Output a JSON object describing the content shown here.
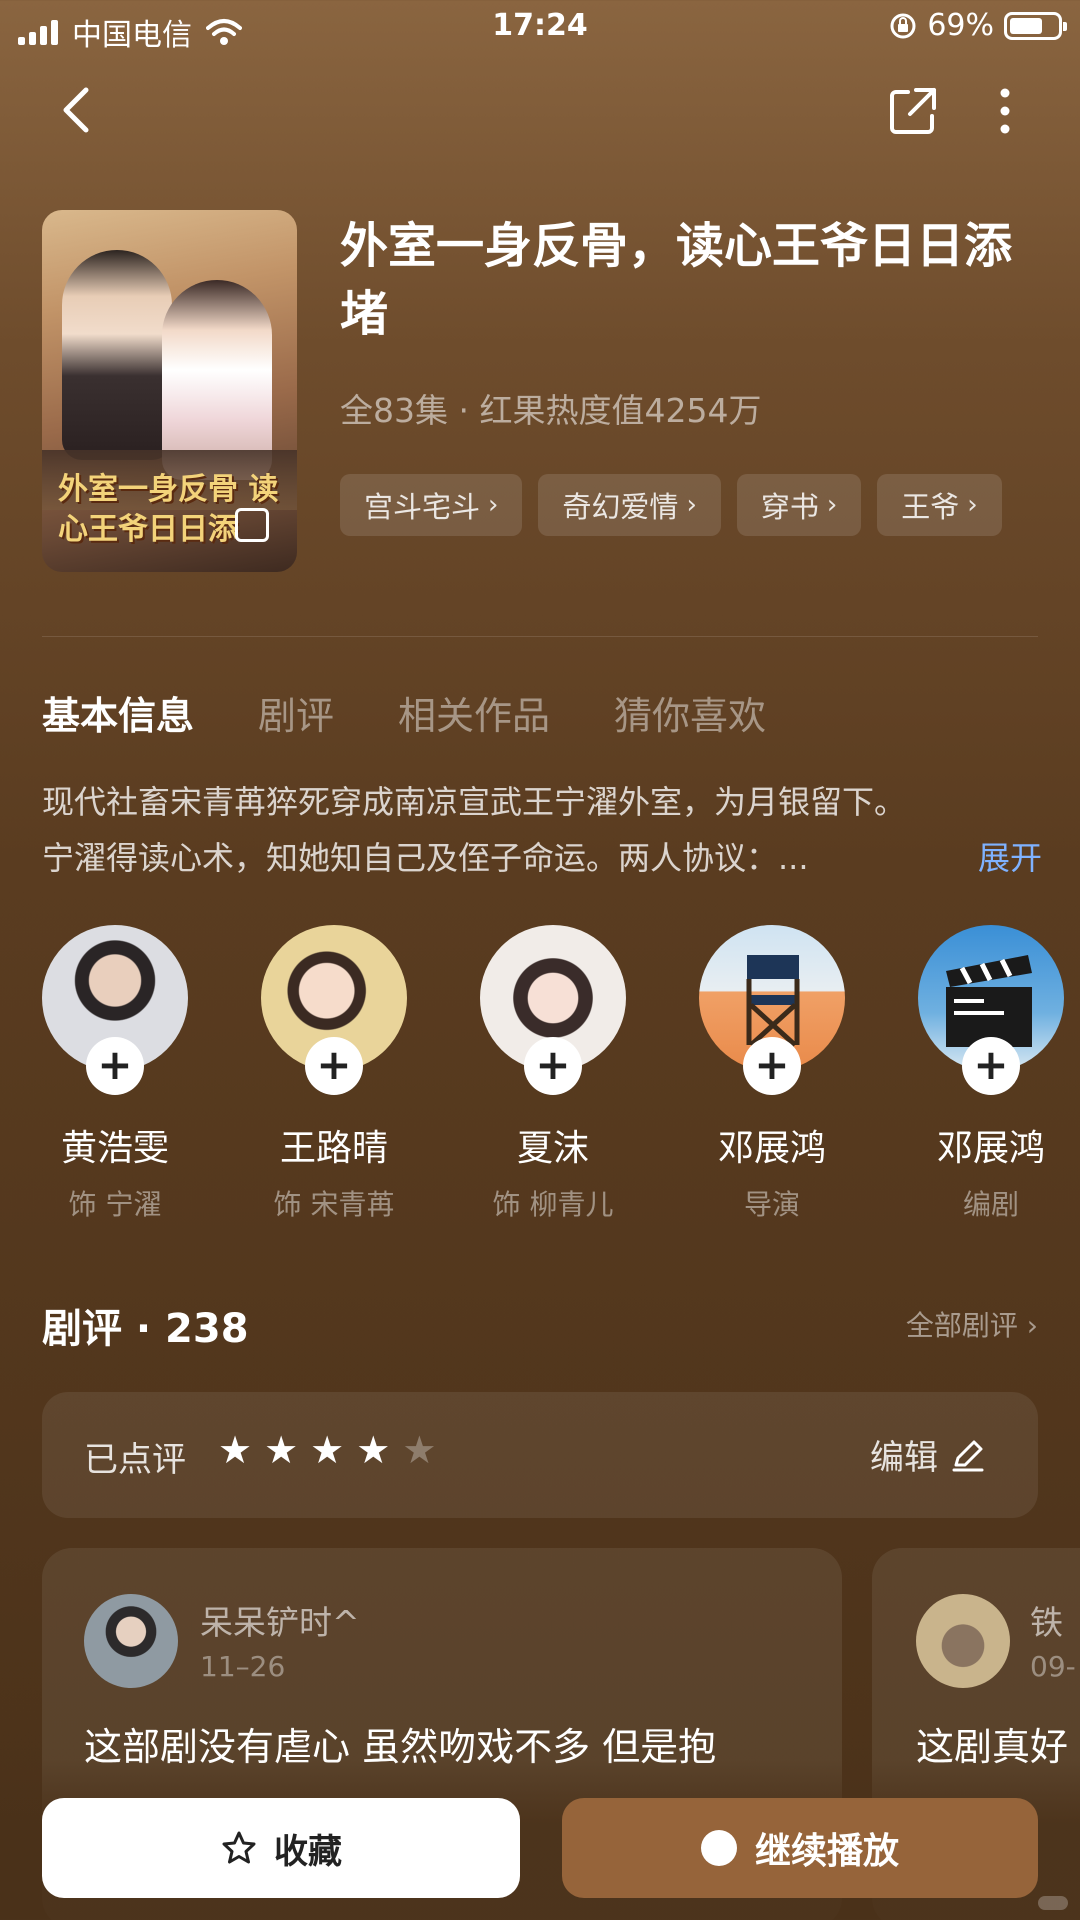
{
  "status_bar": {
    "carrier": "中国电信",
    "time": "17:24",
    "battery_percent": "69%",
    "battery_level": 0.69
  },
  "show": {
    "poster_title": "外室一身反骨 读心王爷日日添",
    "title": "外室一身反骨，读心王爷日日添堵",
    "meta": "全83集 · 红果热度值4254万",
    "tags": [
      "宫斗宅斗",
      "奇幻爱情",
      "穿书",
      "王爷"
    ]
  },
  "tabs": [
    "基本信息",
    "剧评",
    "相关作品",
    "猜你喜欢"
  ],
  "synopsis": {
    "line1": "现代社畜宋青苒猝死穿成南凉宣武王宁濯外室，为月银留下。",
    "line2": "宁濯得读心术，知她知自己及侄子命运。两人协议：...",
    "expand": "展开"
  },
  "cast": [
    {
      "name": "黄浩雯",
      "role": "饰 宁濯",
      "plus": "+"
    },
    {
      "name": "王路晴",
      "role": "饰 宋青苒",
      "plus": "+"
    },
    {
      "name": "夏沫",
      "role": "饰 柳青儿",
      "plus": "+"
    },
    {
      "name": "邓展鸿",
      "role": "导演",
      "plus": "+"
    },
    {
      "name": "邓展鸿",
      "role": "编剧",
      "plus": "+"
    }
  ],
  "reviews": {
    "heading": "剧评 · 238",
    "all_link": "全部剧评 ›",
    "my_rating_label": "已点评",
    "rating_stars": 4,
    "rating_max": 5,
    "edit_label": "编辑",
    "cards": [
      {
        "user": "呆呆铲时^",
        "date": "11–26",
        "text": "这部剧没有虐心 虽然吻戏不多 但是抱"
      },
      {
        "user": "铁",
        "date": "09-",
        "text": "这剧真好"
      }
    ]
  },
  "actions": {
    "collect": "收藏",
    "play": "继续播放"
  },
  "colors": {
    "accent_play": "#96643a",
    "expand_link": "#7fb2ff"
  }
}
